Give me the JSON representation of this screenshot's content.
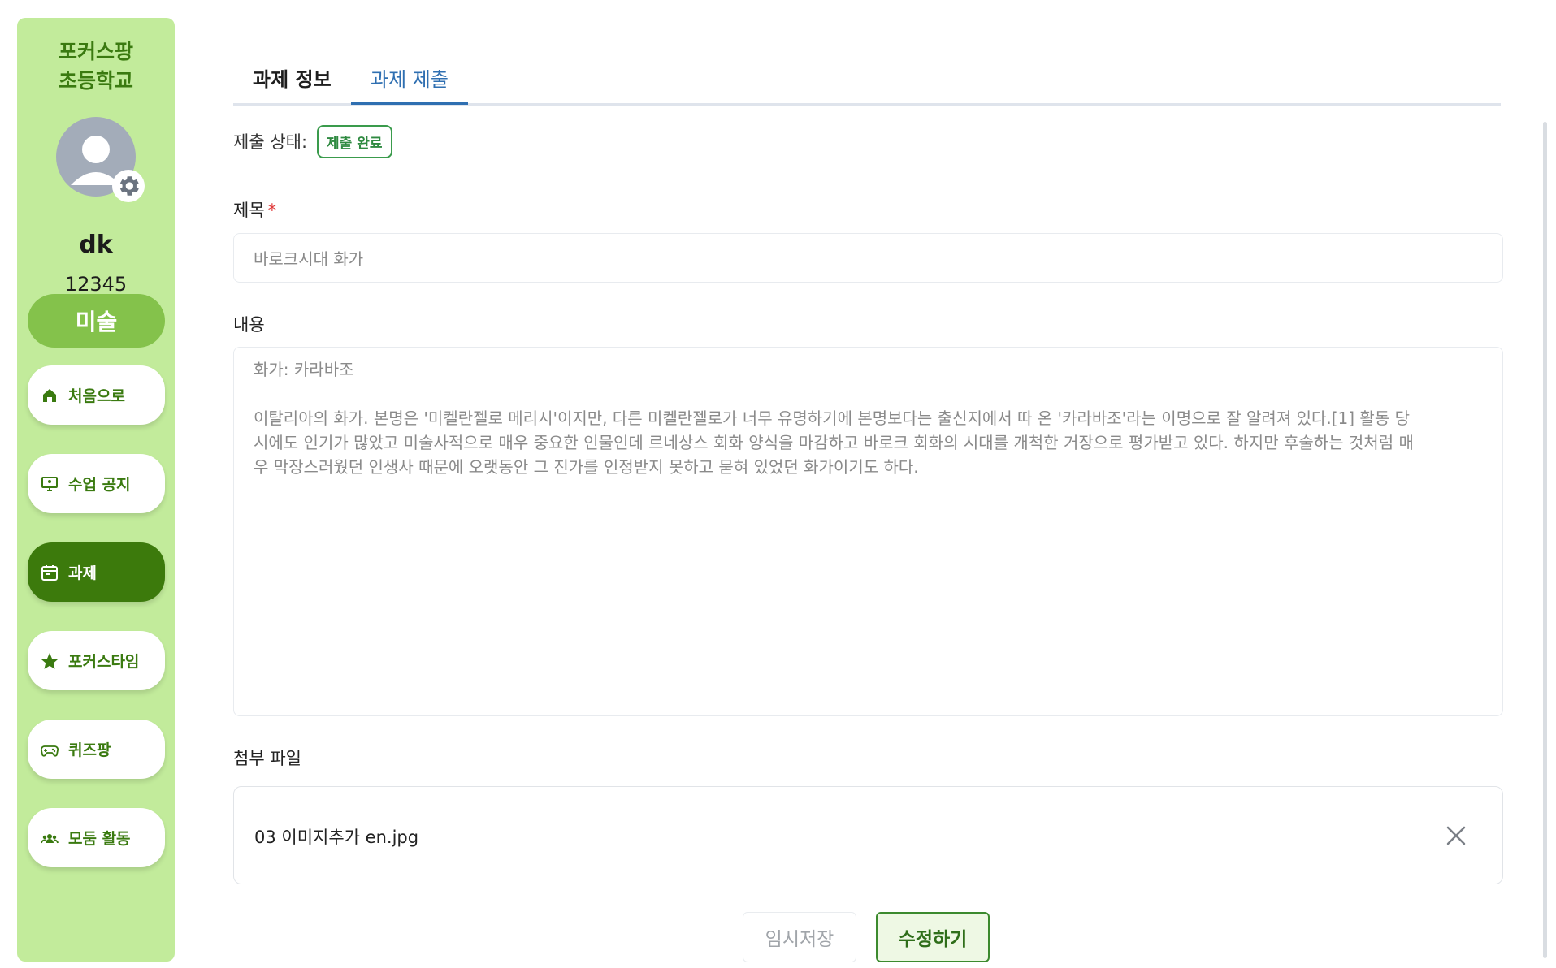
{
  "sidebar": {
    "school_name": "포커스팡\n초등학교",
    "user_name": "dk",
    "user_id": "12345",
    "subject": "미술",
    "items": [
      {
        "label": "처음으로",
        "icon": "home-icon"
      },
      {
        "label": "수업 공지",
        "icon": "presentation-icon"
      },
      {
        "label": "과제",
        "icon": "calendar-icon",
        "active": true
      },
      {
        "label": "포커스타임",
        "icon": "star-icon"
      },
      {
        "label": "퀴즈팡",
        "icon": "gamepad-icon"
      },
      {
        "label": "모둠 활동",
        "icon": "group-icon"
      }
    ]
  },
  "tabs": [
    {
      "label": "과제 정보",
      "active": false
    },
    {
      "label": "과제 제출",
      "active": true
    }
  ],
  "submission": {
    "status_label": "제출 상태:",
    "status_badge": "제출 완료"
  },
  "form": {
    "title_label": "제목",
    "required_mark": "*",
    "title_value": "바로크시대 화가",
    "content_label": "내용",
    "content_value": "화가: 카라바조\n\n이탈리아의 화가. 본명은 '미켈란젤로 메리시'이지만, 다른 미켈란젤로가 너무 유명하기에 본명보다는 출신지에서 따 온 '카라바조'라는 이명으로 잘 알려져 있다.[1] 활동 당\n시에도 인기가 많았고 미술사적으로 매우 중요한 인물인데 르네상스 회화 양식을 마감하고 바로크 회화의 시대를 개척한 거장으로 평가받고 있다. 하지만 후술하는 것처럼 매\n우 막장스러웠던 인생사 때문에 오랫동안 그 진가를 인정받지 못하고 묻혀 있었던 화가이기도 하다.",
    "attachment_label": "첨부 파일",
    "attachment_name": "03 이미지추가 en.jpg"
  },
  "buttons": {
    "temp_save": "임시저장",
    "edit": "수정하기"
  },
  "colors": {
    "sidebar_bg": "#c2eb9b",
    "accent_green": "#3c7a0c",
    "tab_blue": "#2f6fb1",
    "badge_green": "#2f8a41"
  }
}
